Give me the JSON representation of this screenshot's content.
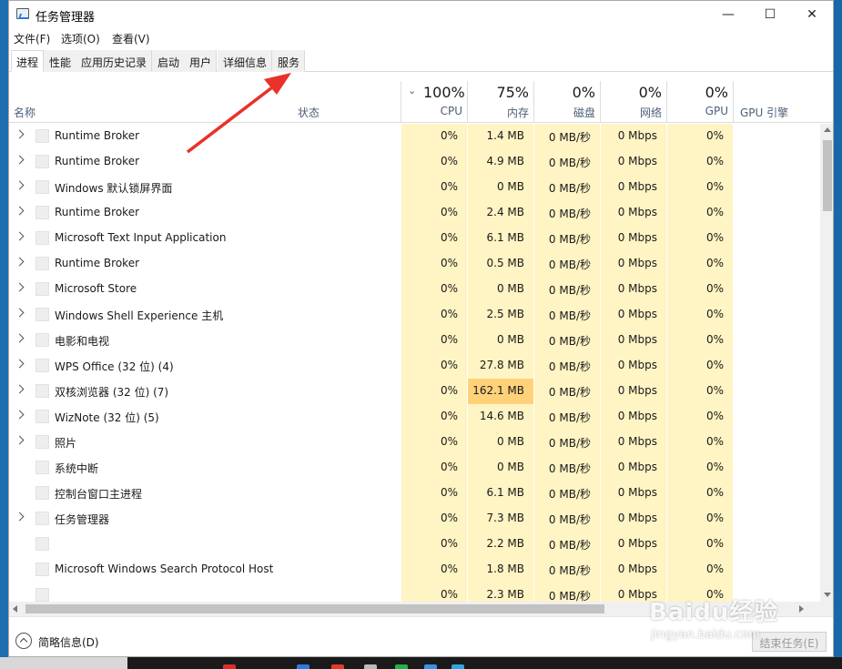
{
  "window": {
    "title": "任务管理器"
  },
  "controls": {
    "minimize": "—",
    "maximize": "☐",
    "close": "✕"
  },
  "menu": [
    "文件(F)",
    "选项(O)",
    "查看(V)"
  ],
  "tabs": [
    "进程",
    "性能",
    "应用历史记录",
    "启动",
    "用户",
    "详细信息",
    "服务"
  ],
  "header": {
    "name": "名称",
    "status": "状态",
    "cpu": {
      "pct": "100%",
      "label": "CPU"
    },
    "memory": {
      "pct": "75%",
      "label": "内存"
    },
    "disk": {
      "pct": "0%",
      "label": "磁盘"
    },
    "network": {
      "pct": "0%",
      "label": "网络"
    },
    "gpu": {
      "pct": "0%",
      "label": "GPU"
    },
    "gpu_engine": "GPU 引擎"
  },
  "rows": [
    {
      "name": "Runtime Broker",
      "expand": true,
      "cpu": "0%",
      "mem": "1.4 MB",
      "disk": "0 MB/秒",
      "net": "0 Mbps",
      "gpu": "0%",
      "hot": false
    },
    {
      "name": "Runtime Broker",
      "expand": true,
      "cpu": "0%",
      "mem": "4.9 MB",
      "disk": "0 MB/秒",
      "net": "0 Mbps",
      "gpu": "0%",
      "hot": false
    },
    {
      "name": "Windows 默认锁屏界面",
      "expand": true,
      "cpu": "0%",
      "mem": "0 MB",
      "disk": "0 MB/秒",
      "net": "0 Mbps",
      "gpu": "0%",
      "hot": false
    },
    {
      "name": "Runtime Broker",
      "expand": true,
      "cpu": "0%",
      "mem": "2.4 MB",
      "disk": "0 MB/秒",
      "net": "0 Mbps",
      "gpu": "0%",
      "hot": false
    },
    {
      "name": "Microsoft Text Input Application",
      "expand": true,
      "cpu": "0%",
      "mem": "6.1 MB",
      "disk": "0 MB/秒",
      "net": "0 Mbps",
      "gpu": "0%",
      "hot": false
    },
    {
      "name": "Runtime Broker",
      "expand": true,
      "cpu": "0%",
      "mem": "0.5 MB",
      "disk": "0 MB/秒",
      "net": "0 Mbps",
      "gpu": "0%",
      "hot": false
    },
    {
      "name": "Microsoft Store",
      "expand": true,
      "cpu": "0%",
      "mem": "0 MB",
      "disk": "0 MB/秒",
      "net": "0 Mbps",
      "gpu": "0%",
      "hot": false
    },
    {
      "name": "Windows Shell Experience 主机",
      "expand": true,
      "cpu": "0%",
      "mem": "2.5 MB",
      "disk": "0 MB/秒",
      "net": "0 Mbps",
      "gpu": "0%",
      "hot": false
    },
    {
      "name": "电影和电视",
      "expand": true,
      "cpu": "0%",
      "mem": "0 MB",
      "disk": "0 MB/秒",
      "net": "0 Mbps",
      "gpu": "0%",
      "hot": false
    },
    {
      "name": "WPS Office (32 位) (4)",
      "expand": true,
      "cpu": "0%",
      "mem": "27.8 MB",
      "disk": "0 MB/秒",
      "net": "0 Mbps",
      "gpu": "0%",
      "hot": false
    },
    {
      "name": "双核浏览器 (32 位) (7)",
      "expand": true,
      "cpu": "0%",
      "mem": "162.1 MB",
      "disk": "0 MB/秒",
      "net": "0 Mbps",
      "gpu": "0%",
      "hot": true
    },
    {
      "name": "WizNote (32 位) (5)",
      "expand": true,
      "cpu": "0%",
      "mem": "14.6 MB",
      "disk": "0 MB/秒",
      "net": "0 Mbps",
      "gpu": "0%",
      "hot": false
    },
    {
      "name": "照片",
      "expand": true,
      "cpu": "0%",
      "mem": "0 MB",
      "disk": "0 MB/秒",
      "net": "0 Mbps",
      "gpu": "0%",
      "hot": false
    },
    {
      "name": "系统中断",
      "expand": false,
      "cpu": "0%",
      "mem": "0 MB",
      "disk": "0 MB/秒",
      "net": "0 Mbps",
      "gpu": "0%",
      "hot": false
    },
    {
      "name": "控制台窗口主进程",
      "expand": false,
      "cpu": "0%",
      "mem": "6.1 MB",
      "disk": "0 MB/秒",
      "net": "0 Mbps",
      "gpu": "0%",
      "hot": false
    },
    {
      "name": "任务管理器",
      "expand": true,
      "cpu": "0%",
      "mem": "7.3 MB",
      "disk": "0 MB/秒",
      "net": "0 Mbps",
      "gpu": "0%",
      "hot": false
    },
    {
      "name": "",
      "expand": false,
      "cpu": "0%",
      "mem": "2.2 MB",
      "disk": "0 MB/秒",
      "net": "0 Mbps",
      "gpu": "0%",
      "hot": false
    },
    {
      "name": "Microsoft Windows Search Protocol Host",
      "expand": false,
      "cpu": "0%",
      "mem": "1.8 MB",
      "disk": "0 MB/秒",
      "net": "0 Mbps",
      "gpu": "0%",
      "hot": false
    },
    {
      "name": "",
      "expand": false,
      "cpu": "0%",
      "mem": "2.3 MB",
      "disk": "0 MB/秒",
      "net": "0 Mbps",
      "gpu": "0%",
      "hot": false
    }
  ],
  "footer": {
    "fewer": "简略信息(D)",
    "end_task": "结束任务(E)"
  },
  "watermark": {
    "logo": "Baidu经验",
    "sub": "jingyan.baidu.com"
  },
  "colors": {
    "cell": "#fff4c4",
    "hot": "#ffd27a",
    "arrow": "#e8322a"
  }
}
